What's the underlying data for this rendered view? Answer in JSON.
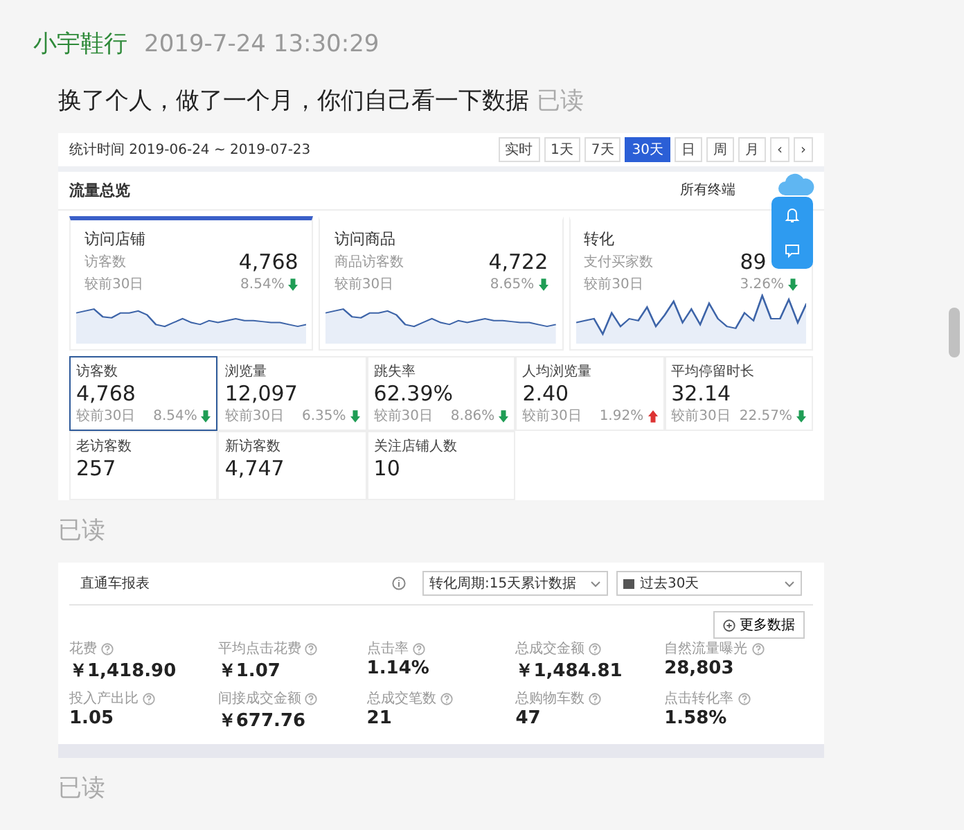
{
  "sender": {
    "name": "小宇鞋行",
    "time": "2019-7-24 13:30:29"
  },
  "messages": [
    {
      "kind": "text",
      "text": "换了个人，做了一个月，你们自己看一下数据",
      "status": "已读"
    },
    {
      "kind": "traffic_report",
      "status": "已读",
      "period": "统计时间 2019-06-24 ~ 2019-07-23",
      "ranges": [
        {
          "label": "实时",
          "selected": false
        },
        {
          "label": "1天",
          "selected": false
        },
        {
          "label": "7天",
          "selected": false
        },
        {
          "label": "30天",
          "selected": true
        },
        {
          "label": "日",
          "selected": false
        },
        {
          "label": "周",
          "selected": false
        },
        {
          "label": "月",
          "selected": false
        },
        {
          "label": "‹",
          "selected": false
        },
        {
          "label": "›",
          "selected": false
        }
      ],
      "title": "流量总览",
      "terminal": "所有终端",
      "cards": [
        {
          "title": "访问店铺",
          "metric": "访客数",
          "value": "4,768",
          "compare": "较前30日",
          "change": "8.54%",
          "rising": false,
          "selected": true
        },
        {
          "title": "访问商品",
          "metric": "商品访客数",
          "value": "4,722",
          "compare": "较前30日",
          "change": "8.65%",
          "rising": false,
          "selected": false
        },
        {
          "title": "转化",
          "metric": "支付买家数",
          "value": "89",
          "compare": "较前30日",
          "change": "3.26%",
          "rising": false,
          "selected": false
        }
      ],
      "metrics": [
        {
          "label": "访客数",
          "value": "4,768",
          "compare": "较前30日",
          "change": "8.54%",
          "rising": false,
          "selected": true
        },
        {
          "label": "浏览量",
          "value": "12,097",
          "compare": "较前30日",
          "change": "6.35%",
          "rising": false,
          "selected": false
        },
        {
          "label": "跳失率",
          "value": "62.39%",
          "compare": "较前30日",
          "change": "8.86%",
          "rising": false,
          "selected": false
        },
        {
          "label": "人均浏览量",
          "value": "2.40",
          "compare": "较前30日",
          "change": "1.92%",
          "rising": true,
          "selected": false
        },
        {
          "label": "平均停留时长",
          "value": "32.14",
          "compare": "较前30日",
          "change": "22.57%",
          "rising": false,
          "selected": false
        },
        {
          "label": "老访客数",
          "value": "257",
          "selected": false
        },
        {
          "label": "新访客数",
          "value": "4,747",
          "selected": false
        },
        {
          "label": "关注店铺人数",
          "value": "10",
          "selected": false
        }
      ]
    },
    {
      "kind": "ad_report",
      "status": "已读",
      "title": "直通车报表",
      "cycle": "转化周期:15天累计数据",
      "range": "过去30天",
      "more": "更多数据",
      "metrics": [
        {
          "label": "花费",
          "value": "￥1,418.90"
        },
        {
          "label": "平均点击花费",
          "value": "￥1.07"
        },
        {
          "label": "点击率",
          "value": "1.14%"
        },
        {
          "label": "总成交金额",
          "value": "￥1,484.81"
        },
        {
          "label": "自然流量曝光",
          "value": "28,803"
        },
        {
          "label": "投入产出比",
          "value": "1.05"
        },
        {
          "label": "间接成交金额",
          "value": "￥677.76"
        },
        {
          "label": "总成交笔数",
          "value": "21"
        },
        {
          "label": "总购物车数",
          "value": "47"
        },
        {
          "label": "点击转化率",
          "value": "1.58%"
        }
      ]
    }
  ]
}
